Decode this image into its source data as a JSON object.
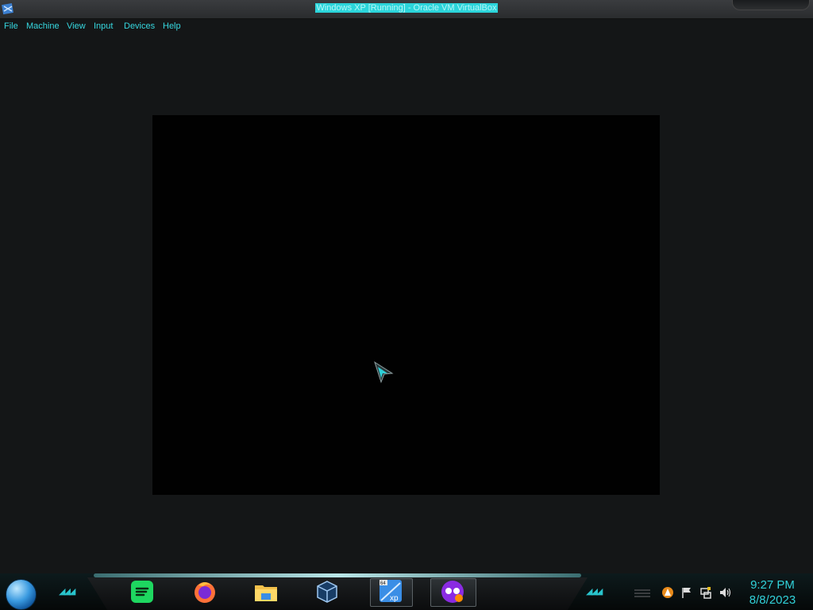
{
  "window": {
    "title": "Windows XP [Running] - Oracle VM VirtualBox"
  },
  "menu": {
    "items": [
      "File",
      "Machine",
      "View",
      "Input",
      "Devices",
      "Help"
    ]
  },
  "taskbar": {
    "apps": [
      {
        "name": "spotify-icon",
        "color": "#1ed760"
      },
      {
        "name": "firefox-icon",
        "color": "#ff7139"
      },
      {
        "name": "file-explorer-icon",
        "color": "#f3c14b"
      },
      {
        "name": "virtualbox-icon",
        "color": "#2f7fd0"
      },
      {
        "name": "windows-xp-vm-icon",
        "color": "#3a8ee6"
      },
      {
        "name": "app-purple-icon",
        "color": "#8a2be2"
      }
    ],
    "tray": [
      "warning-icon",
      "flag-icon",
      "network-icon",
      "volume-icon"
    ]
  },
  "clock": {
    "time": "9:27 PM",
    "date": "8/8/2023"
  },
  "colors": {
    "accent": "#31d1d9",
    "background": "#141617",
    "vm_screen": "#010101"
  }
}
